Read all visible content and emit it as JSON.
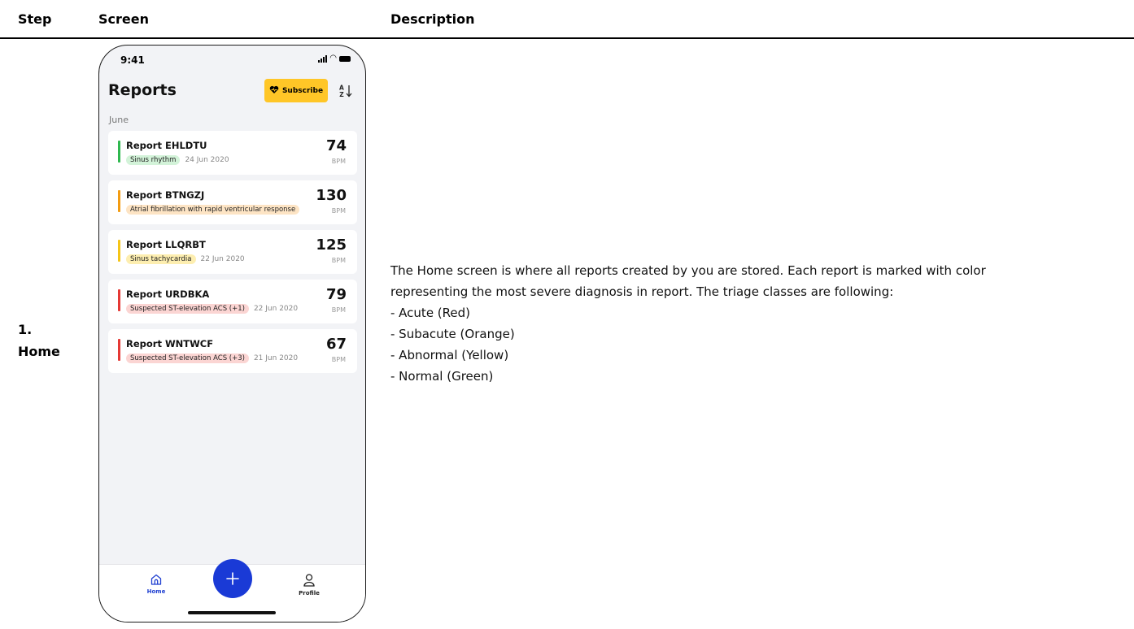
{
  "table": {
    "headers": {
      "step": "Step",
      "screen": "Screen",
      "description": "Description"
    },
    "rows": [
      {
        "step_number": "1.",
        "step_name": "Home",
        "description_lines": [
          "The Home screen is where all reports created by you are stored. Each report is marked with color",
          "representing the most severe diagnosis in report. The triage classes are following:",
          "- Acute (Red)",
          "- Subacute (Orange)",
          "- Abnormal (Yellow)",
          "- Normal (Green)"
        ]
      }
    ]
  },
  "phone": {
    "status_time": "9:41",
    "title": "Reports",
    "subscribe_label": "Subscribe",
    "sort_icon": "sort-az-icon",
    "section": "June",
    "bpm_unit": "BPM",
    "reports": [
      {
        "title": "Report EHLDTU",
        "tag": "Sinus rhythm",
        "date": "24 Jun 2020",
        "bpm": "74",
        "color": "#2fb84f",
        "tag_bg": "#d3f3d9"
      },
      {
        "title": "Report BTNGZJ",
        "tag": "Atrial fibrillation with rapid ventricular response",
        "date": "",
        "bpm": "130",
        "color": "#f39c12",
        "tag_bg": "#fde4c4"
      },
      {
        "title": "Report LLQRBT",
        "tag": "Sinus tachycardia",
        "date": "22 Jun 2020",
        "bpm": "125",
        "color": "#f5c518",
        "tag_bg": "#fdeeb0"
      },
      {
        "title": "Report URDBKA",
        "tag": "Suspected ST-elevation ACS (+1)",
        "date": "22 Jun 2020",
        "bpm": "79",
        "color": "#e53935",
        "tag_bg": "#fbd5d3"
      },
      {
        "title": "Report WNTWCF",
        "tag": "Suspected ST-elevation ACS (+3)",
        "date": "21 Jun 2020",
        "bpm": "67",
        "color": "#e53935",
        "tag_bg": "#fbd5d3"
      }
    ],
    "tabs": {
      "home": "Home",
      "profile": "Profile"
    },
    "accent": "#1a3ad6",
    "subscribe_color": "#ffc627"
  }
}
